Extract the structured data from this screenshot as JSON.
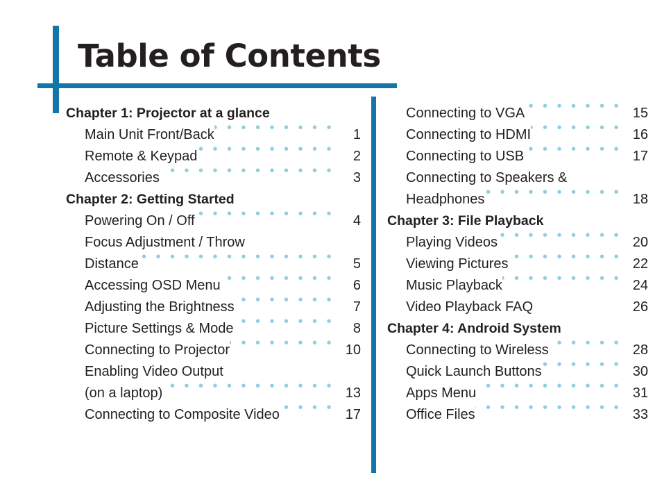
{
  "document": {
    "title": "Table of Contents"
  },
  "theme": {
    "accent_blue": "#1277A8",
    "leader_dot_blue": "#92CDE0",
    "text_black": "#231F20",
    "background": "#FFFFFF"
  },
  "columns": {
    "left": [
      {
        "kind": "chapter",
        "label": "Chapter 1: Projector at a glance",
        "page": "",
        "leader": false
      },
      {
        "kind": "entry",
        "label": "Main Unit Front/Back",
        "page": "1",
        "leader": true
      },
      {
        "kind": "entry",
        "label": "Remote & Keypad",
        "page": "2",
        "leader": true
      },
      {
        "kind": "entry",
        "label": "Accessories",
        "page": "3",
        "leader": true
      },
      {
        "kind": "chapter",
        "label": "Chapter 2: Getting Started",
        "page": "",
        "leader": false
      },
      {
        "kind": "entry",
        "label": "Powering On / Off",
        "page": "4",
        "leader": true
      },
      {
        "kind": "entry",
        "label": "Focus Adjustment / Throw",
        "page": "",
        "leader": false,
        "continued": true
      },
      {
        "kind": "entry",
        "label": "Distance",
        "page": "5",
        "leader": true
      },
      {
        "kind": "entry",
        "label": "Accessing OSD Menu",
        "page": "6",
        "leader": true
      },
      {
        "kind": "entry",
        "label": "Adjusting the Brightness",
        "page": "7",
        "leader": true
      },
      {
        "kind": "entry",
        "label": "Picture Settings & Mode",
        "page": "8",
        "leader": true
      },
      {
        "kind": "entry",
        "label": "Connecting to Projector",
        "page": "10",
        "leader": true
      },
      {
        "kind": "entry",
        "label": "Enabling Video Output",
        "page": "",
        "leader": false,
        "continued": true
      },
      {
        "kind": "entry",
        "label": "(on a laptop)",
        "page": "13",
        "leader": true
      },
      {
        "kind": "entry",
        "label": "Connecting to Composite Video",
        "page": "17",
        "leader": true
      }
    ],
    "right": [
      {
        "kind": "entry",
        "label": "Connecting to VGA",
        "page": "15",
        "leader": true
      },
      {
        "kind": "entry",
        "label": "Connecting to HDMI",
        "page": "16",
        "leader": true
      },
      {
        "kind": "entry",
        "label": "Connecting to USB",
        "page": "17",
        "leader": true
      },
      {
        "kind": "entry",
        "label": "Connecting to Speakers &",
        "page": "",
        "leader": false,
        "continued": true
      },
      {
        "kind": "entry",
        "label": "Headphones",
        "page": "18",
        "leader": true
      },
      {
        "kind": "chapter",
        "label": "Chapter 3: File Playback",
        "page": "",
        "leader": false
      },
      {
        "kind": "entry",
        "label": "Playing Videos",
        "page": "20",
        "leader": true
      },
      {
        "kind": "entry",
        "label": "Viewing Pictures",
        "page": "22",
        "leader": true
      },
      {
        "kind": "entry",
        "label": "Music Playback",
        "page": "24",
        "leader": true
      },
      {
        "kind": "entry",
        "label": "Video Playback FAQ",
        "page": "26",
        "leader": false
      },
      {
        "kind": "chapter",
        "label": "Chapter 4: Android System",
        "page": "",
        "leader": false
      },
      {
        "kind": "entry",
        "label": "Connecting to Wireless",
        "page": "28",
        "leader": true
      },
      {
        "kind": "entry",
        "label": "Quick Launch Buttons",
        "page": "30",
        "leader": true
      },
      {
        "kind": "entry",
        "label": "Apps Menu",
        "page": "31",
        "leader": true
      },
      {
        "kind": "entry",
        "label": "Office Files",
        "page": "33",
        "leader": true
      }
    ]
  }
}
